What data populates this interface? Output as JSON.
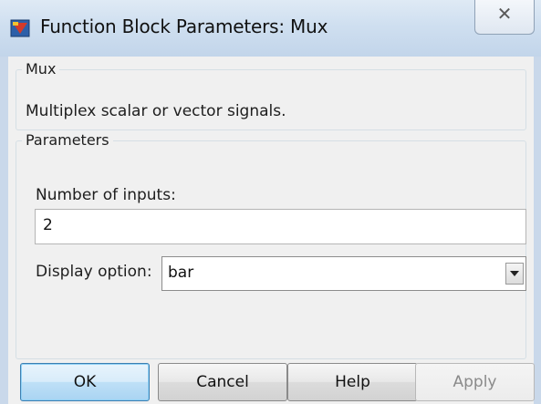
{
  "window": {
    "title": "Function Block Parameters: Mux",
    "close_glyph": "✕",
    "app_icon": "simulink-block-icon"
  },
  "block_group": {
    "label": "Mux",
    "description": "Multiplex scalar or vector signals."
  },
  "parameters_group": {
    "label": "Parameters",
    "number_of_inputs_label": "Number of inputs:",
    "number_of_inputs_value": "2",
    "display_option_label": "Display option:",
    "display_option_value": "bar"
  },
  "buttons": {
    "ok": "OK",
    "cancel": "Cancel",
    "help": "Help",
    "apply": "Apply"
  },
  "colors": {
    "titlebar": "#cfdff0",
    "client_background": "#f0f0f0",
    "default_button_border": "#3c7fb1"
  }
}
